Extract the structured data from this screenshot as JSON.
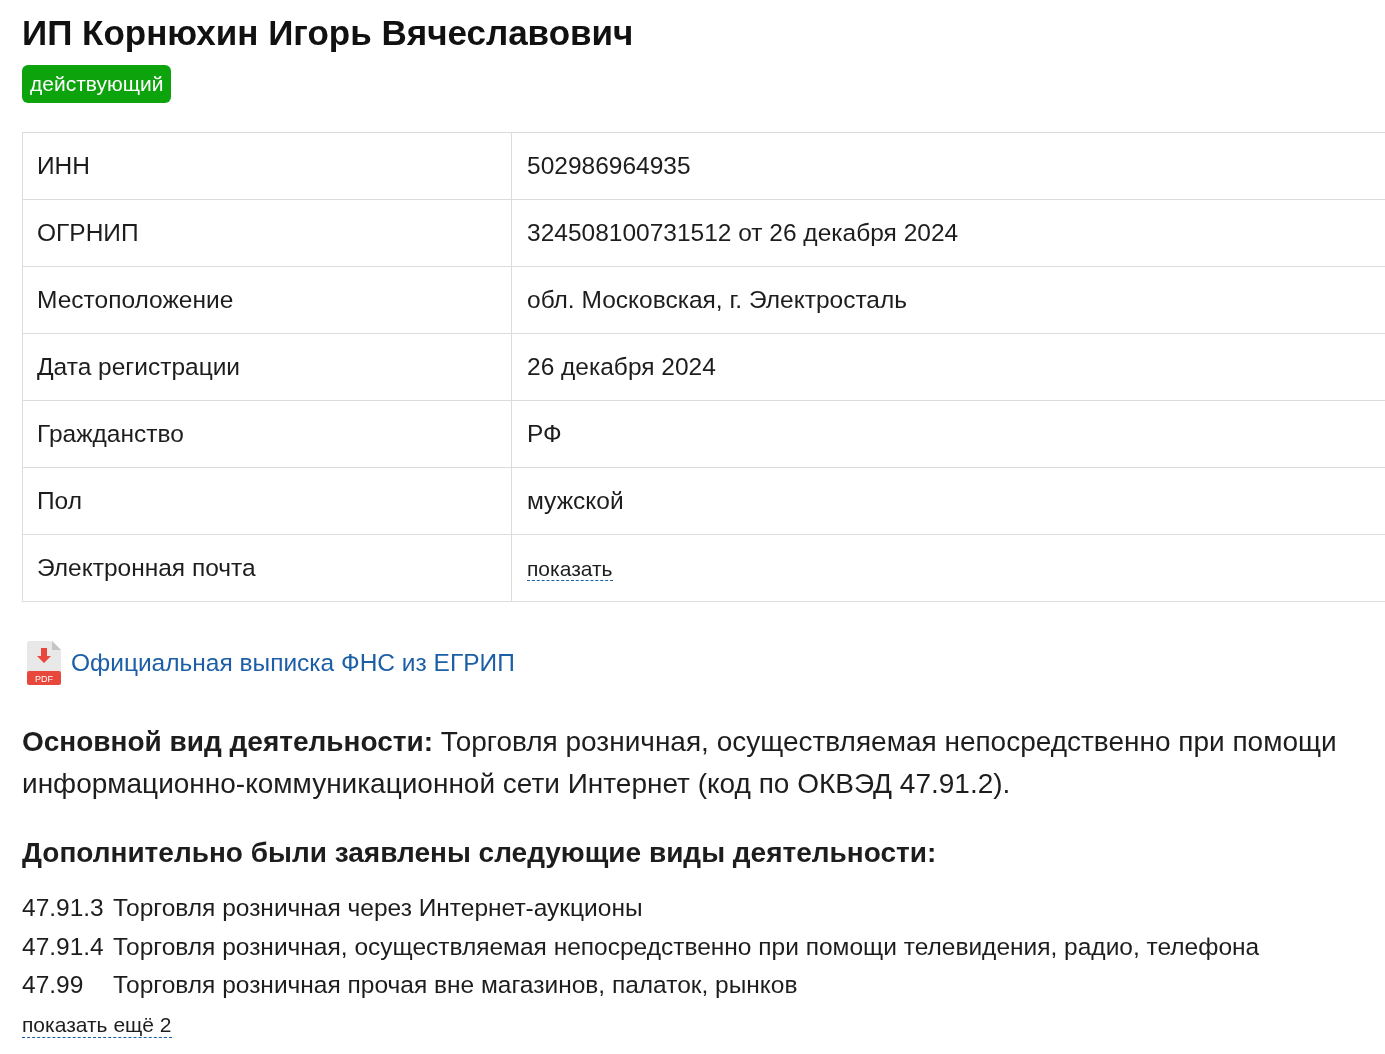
{
  "title": "ИП Корнюхин Игорь Вячеславович",
  "status_badge": "действующий",
  "details": [
    {
      "label": "ИНН",
      "value": "502986964935",
      "kind": "text"
    },
    {
      "label": "ОГРНИП",
      "value": "324508100731512 от 26 декабря 2024",
      "kind": "text"
    },
    {
      "label": "Местоположение",
      "value": "обл. Московская, г. Электросталь",
      "kind": "text"
    },
    {
      "label": "Дата регистрации",
      "value": "26 декабря 2024",
      "kind": "text"
    },
    {
      "label": "Гражданство",
      "value": "РФ",
      "kind": "text"
    },
    {
      "label": "Пол",
      "value": "мужской",
      "kind": "text"
    },
    {
      "label": "Электронная почта",
      "value": "показать",
      "kind": "reveal"
    }
  ],
  "extract": {
    "file_type": "PDF",
    "link": "Официальная выписка ФНС из ЕГРИП"
  },
  "main_activity": "**Основной вид деятельности:** Торговля розничная, осуществляемая непосредственно при помощи информационно-коммуникационной сети Интернет (код по ОКВЭД 47.91.2).",
  "additional_heading": "Дополнительно были заявлены следующие виды деятельности:",
  "additional_activities": [
    {
      "code": "47.91.3",
      "name": "Торговля розничная через Интернет-аукционы"
    },
    {
      "code": "47.91.4",
      "name": "Торговля розничная, осуществляемая непосредственно при помощи телевидения, радио, телефона"
    },
    {
      "code": "47.99",
      "name": "Торговля розничная прочая вне магазинов, палаток, рынков"
    }
  ],
  "show_more": "показать ещё 2"
}
